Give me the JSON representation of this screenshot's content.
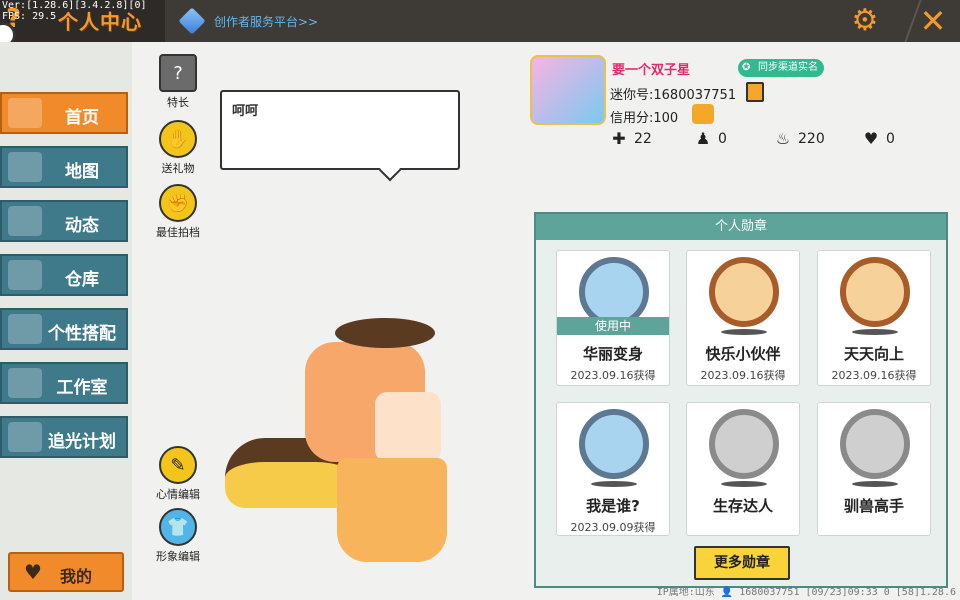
{
  "topbar": {
    "version": "Ver:[1.28.6][3.4.2.8][0] FPS: 29.5",
    "title": "个人中心",
    "help_icon": "question-icon",
    "creator_platform": "创作者服务平台>>",
    "settings_icon": "gear-icon",
    "close_icon": "close-icon"
  },
  "sidebar": {
    "items": [
      {
        "label": "首页",
        "icon": "home-icon",
        "active": true
      },
      {
        "label": "地图",
        "icon": "map-icon",
        "active": false
      },
      {
        "label": "动态",
        "icon": "bell-icon",
        "active": false
      },
      {
        "label": "仓库",
        "icon": "house-icon",
        "active": false
      },
      {
        "label": "个性搭配",
        "icon": "shirt-icon",
        "active": false
      },
      {
        "label": "工作室",
        "icon": "studio-icon",
        "active": false
      },
      {
        "label": "追光计划",
        "icon": "light-icon",
        "active": false
      }
    ],
    "mine_label": "我的"
  },
  "actions": {
    "specialty": "特长",
    "send_gift": "送礼物",
    "best_photo": "最佳拍档",
    "mood_edit": "心情编辑",
    "image_edit": "形象编辑"
  },
  "bubble": {
    "text": "呵呵"
  },
  "profile": {
    "nickname": "要一个双子星",
    "verify_label": "同步渠道实名",
    "mini_id": "迷你号:1680037751",
    "credit": "信用分:100",
    "stats": [
      {
        "icon": "plus-icon",
        "value": "22"
      },
      {
        "icon": "person-icon",
        "value": "0"
      },
      {
        "icon": "fire-icon",
        "value": "220"
      },
      {
        "icon": "heart-icon",
        "value": "0"
      }
    ]
  },
  "badges": {
    "header": "个人勋章",
    "in_use_label": "使用中",
    "items": [
      {
        "name": "华丽变身",
        "date": "2023.09.16获得",
        "style": "blue",
        "in_use": true
      },
      {
        "name": "快乐小伙伴",
        "date": "2023.09.16获得",
        "style": "bronze",
        "in_use": false
      },
      {
        "name": "天天向上",
        "date": "2023.09.16获得",
        "style": "bronze",
        "in_use": false
      },
      {
        "name": "我是谁?",
        "date": "2023.09.09获得",
        "style": "blue",
        "in_use": false
      },
      {
        "name": "生存达人",
        "date": "",
        "style": "grey",
        "in_use": false
      },
      {
        "name": "驯兽高手",
        "date": "",
        "style": "grey",
        "in_use": false
      }
    ],
    "more_label": "更多勋章"
  },
  "footer": "IP属地:山东 👤 1680037751 [09/23]09:33 0 [58]1.28.6"
}
